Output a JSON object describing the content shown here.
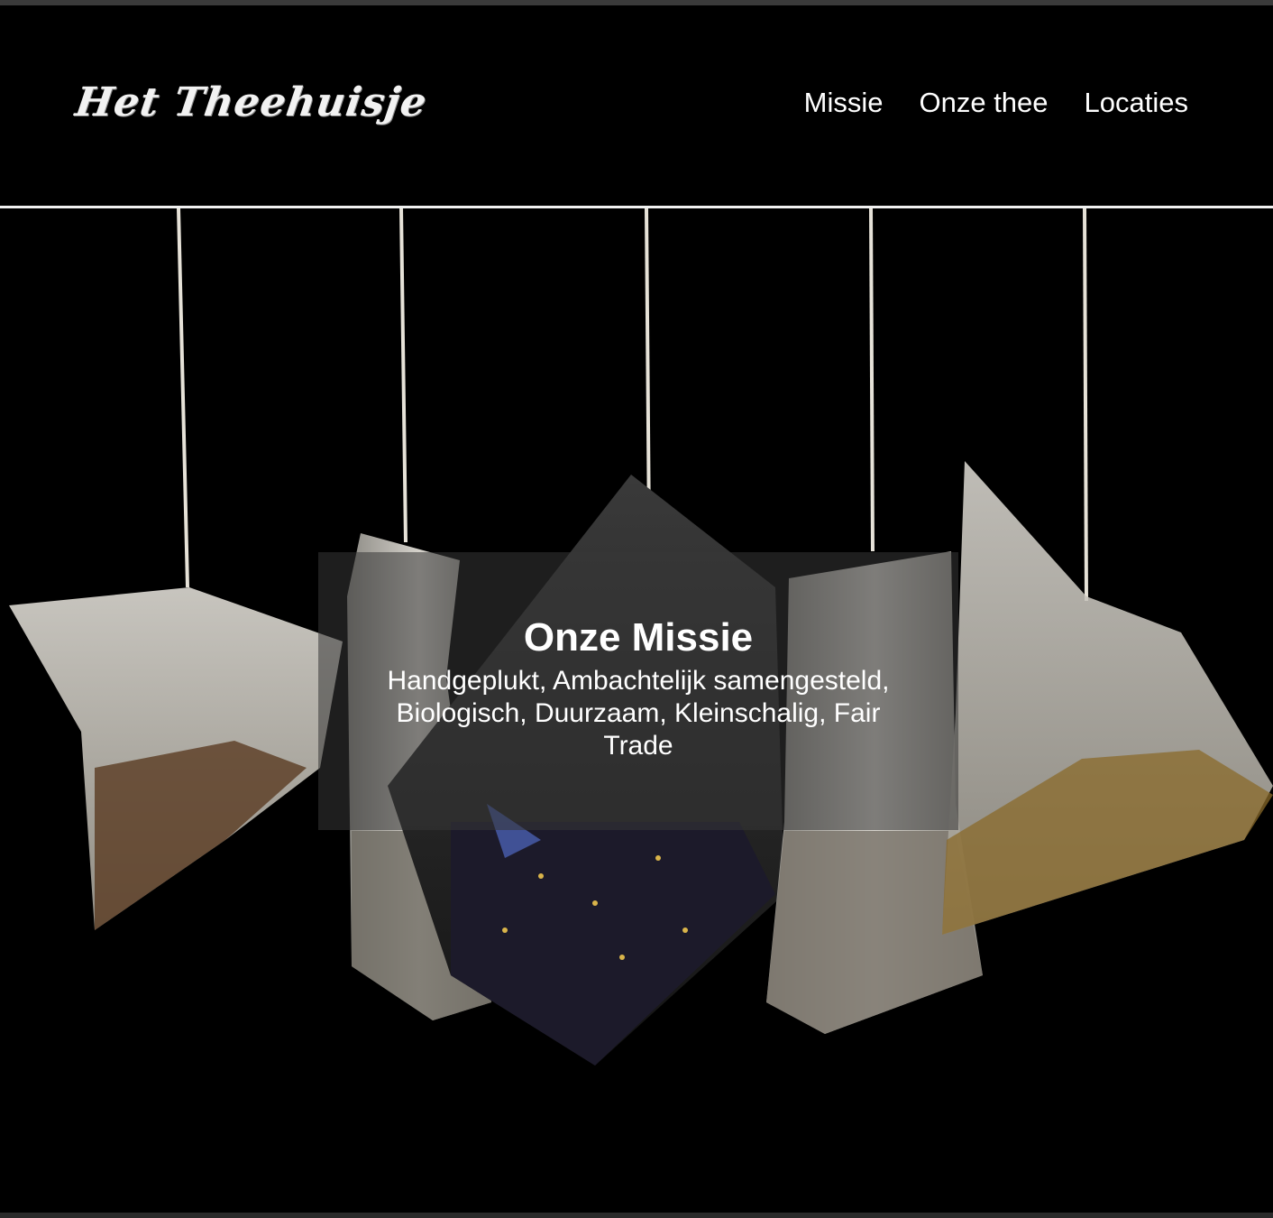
{
  "header": {
    "logo_text": "Het Theehuisje",
    "nav": {
      "missie": "Missie",
      "onze_thee": "Onze thee",
      "locaties": "Locaties"
    }
  },
  "hero": {
    "image": "tea-bags-hanging-on-strings",
    "title": "Onze Missie",
    "text": "Handgeplukt, Ambachtelijk samengesteld, Biologisch, Duurzaam, Kleinschalig, Fair Trade"
  },
  "colors": {
    "background": "#000000",
    "text": "#ffffff",
    "divider": "#f0f0f0"
  }
}
